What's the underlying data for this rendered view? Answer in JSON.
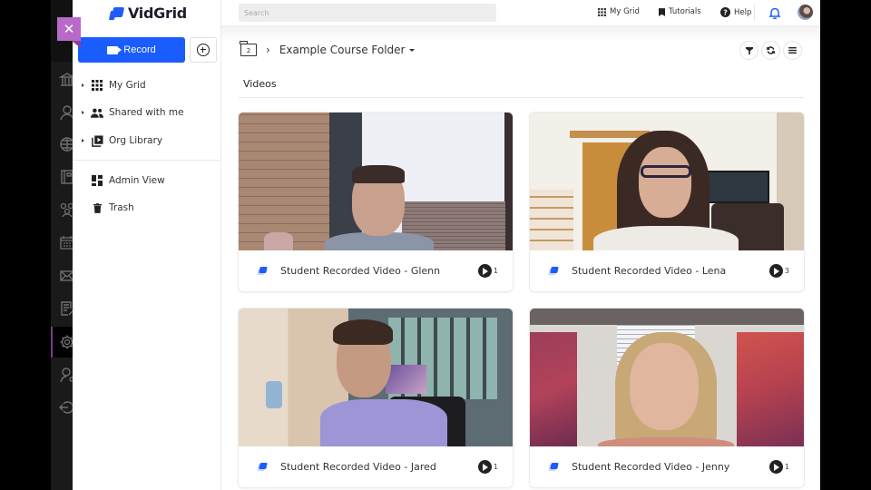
{
  "app": {
    "brand": "VidGrid",
    "accent_color": "#1b5cff",
    "close_tab_color": "#b969c9"
  },
  "rail": {
    "items": [
      {
        "icon": "bank-icon"
      },
      {
        "icon": "user-icon"
      },
      {
        "icon": "globe-icon"
      },
      {
        "icon": "book-icon"
      },
      {
        "icon": "group-icon"
      },
      {
        "icon": "calendar-icon"
      },
      {
        "icon": "mail-icon"
      },
      {
        "icon": "document-edit-icon"
      },
      {
        "icon": "gear-icon",
        "active": true
      },
      {
        "icon": "user-settings-icon"
      },
      {
        "icon": "logout-icon"
      }
    ]
  },
  "sidebar": {
    "record_label": "Record",
    "items": [
      {
        "label": "My Grid",
        "icon": "grid-icon",
        "expandable": true
      },
      {
        "label": "Shared with me",
        "icon": "people-icon",
        "expandable": true
      },
      {
        "label": "Org Library",
        "icon": "video-library-icon",
        "expandable": true
      },
      {
        "label": "Admin View",
        "icon": "dashboard-icon",
        "expandable": false
      },
      {
        "label": "Trash",
        "icon": "trash-icon",
        "expandable": false
      }
    ]
  },
  "topbar": {
    "search_placeholder": "Search",
    "links": [
      {
        "label": "My Grid",
        "icon": "grid-icon"
      },
      {
        "label": "Tutorials",
        "icon": "bookmark-icon"
      },
      {
        "label": "Help",
        "icon": "help-icon"
      }
    ]
  },
  "main": {
    "folder_count": "2",
    "folder_title": "Example Course Folder",
    "section_title": "Videos",
    "videos": [
      {
        "title": "Student Recorded Video - Glenn",
        "views": "1"
      },
      {
        "title": "Student Recorded Video - Lena",
        "views": "3"
      },
      {
        "title": "Student Recorded Video - Jared",
        "views": "1"
      },
      {
        "title": "Student Recorded Video - Jenny",
        "views": "1"
      }
    ]
  }
}
